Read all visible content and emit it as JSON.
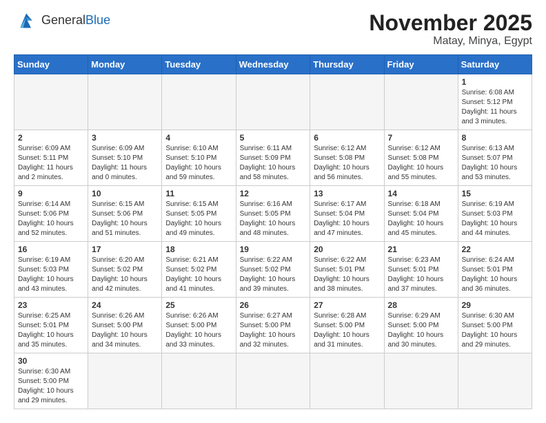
{
  "logo": {
    "text_general": "General",
    "text_blue": "Blue"
  },
  "title": "November 2025",
  "subtitle": "Matay, Minya, Egypt",
  "days_header": [
    "Sunday",
    "Monday",
    "Tuesday",
    "Wednesday",
    "Thursday",
    "Friday",
    "Saturday"
  ],
  "weeks": [
    [
      {
        "day": "",
        "info": ""
      },
      {
        "day": "",
        "info": ""
      },
      {
        "day": "",
        "info": ""
      },
      {
        "day": "",
        "info": ""
      },
      {
        "day": "",
        "info": ""
      },
      {
        "day": "",
        "info": ""
      },
      {
        "day": "1",
        "info": "Sunrise: 6:08 AM\nSunset: 5:12 PM\nDaylight: 11 hours and 3 minutes."
      }
    ],
    [
      {
        "day": "2",
        "info": "Sunrise: 6:09 AM\nSunset: 5:11 PM\nDaylight: 11 hours and 2 minutes."
      },
      {
        "day": "3",
        "info": "Sunrise: 6:09 AM\nSunset: 5:10 PM\nDaylight: 11 hours and 0 minutes."
      },
      {
        "day": "4",
        "info": "Sunrise: 6:10 AM\nSunset: 5:10 PM\nDaylight: 10 hours and 59 minutes."
      },
      {
        "day": "5",
        "info": "Sunrise: 6:11 AM\nSunset: 5:09 PM\nDaylight: 10 hours and 58 minutes."
      },
      {
        "day": "6",
        "info": "Sunrise: 6:12 AM\nSunset: 5:08 PM\nDaylight: 10 hours and 56 minutes."
      },
      {
        "day": "7",
        "info": "Sunrise: 6:12 AM\nSunset: 5:08 PM\nDaylight: 10 hours and 55 minutes."
      },
      {
        "day": "8",
        "info": "Sunrise: 6:13 AM\nSunset: 5:07 PM\nDaylight: 10 hours and 53 minutes."
      }
    ],
    [
      {
        "day": "9",
        "info": "Sunrise: 6:14 AM\nSunset: 5:06 PM\nDaylight: 10 hours and 52 minutes."
      },
      {
        "day": "10",
        "info": "Sunrise: 6:15 AM\nSunset: 5:06 PM\nDaylight: 10 hours and 51 minutes."
      },
      {
        "day": "11",
        "info": "Sunrise: 6:15 AM\nSunset: 5:05 PM\nDaylight: 10 hours and 49 minutes."
      },
      {
        "day": "12",
        "info": "Sunrise: 6:16 AM\nSunset: 5:05 PM\nDaylight: 10 hours and 48 minutes."
      },
      {
        "day": "13",
        "info": "Sunrise: 6:17 AM\nSunset: 5:04 PM\nDaylight: 10 hours and 47 minutes."
      },
      {
        "day": "14",
        "info": "Sunrise: 6:18 AM\nSunset: 5:04 PM\nDaylight: 10 hours and 45 minutes."
      },
      {
        "day": "15",
        "info": "Sunrise: 6:19 AM\nSunset: 5:03 PM\nDaylight: 10 hours and 44 minutes."
      }
    ],
    [
      {
        "day": "16",
        "info": "Sunrise: 6:19 AM\nSunset: 5:03 PM\nDaylight: 10 hours and 43 minutes."
      },
      {
        "day": "17",
        "info": "Sunrise: 6:20 AM\nSunset: 5:02 PM\nDaylight: 10 hours and 42 minutes."
      },
      {
        "day": "18",
        "info": "Sunrise: 6:21 AM\nSunset: 5:02 PM\nDaylight: 10 hours and 41 minutes."
      },
      {
        "day": "19",
        "info": "Sunrise: 6:22 AM\nSunset: 5:02 PM\nDaylight: 10 hours and 39 minutes."
      },
      {
        "day": "20",
        "info": "Sunrise: 6:22 AM\nSunset: 5:01 PM\nDaylight: 10 hours and 38 minutes."
      },
      {
        "day": "21",
        "info": "Sunrise: 6:23 AM\nSunset: 5:01 PM\nDaylight: 10 hours and 37 minutes."
      },
      {
        "day": "22",
        "info": "Sunrise: 6:24 AM\nSunset: 5:01 PM\nDaylight: 10 hours and 36 minutes."
      }
    ],
    [
      {
        "day": "23",
        "info": "Sunrise: 6:25 AM\nSunset: 5:01 PM\nDaylight: 10 hours and 35 minutes."
      },
      {
        "day": "24",
        "info": "Sunrise: 6:26 AM\nSunset: 5:00 PM\nDaylight: 10 hours and 34 minutes."
      },
      {
        "day": "25",
        "info": "Sunrise: 6:26 AM\nSunset: 5:00 PM\nDaylight: 10 hours and 33 minutes."
      },
      {
        "day": "26",
        "info": "Sunrise: 6:27 AM\nSunset: 5:00 PM\nDaylight: 10 hours and 32 minutes."
      },
      {
        "day": "27",
        "info": "Sunrise: 6:28 AM\nSunset: 5:00 PM\nDaylight: 10 hours and 31 minutes."
      },
      {
        "day": "28",
        "info": "Sunrise: 6:29 AM\nSunset: 5:00 PM\nDaylight: 10 hours and 30 minutes."
      },
      {
        "day": "29",
        "info": "Sunrise: 6:30 AM\nSunset: 5:00 PM\nDaylight: 10 hours and 29 minutes."
      }
    ],
    [
      {
        "day": "30",
        "info": "Sunrise: 6:30 AM\nSunset: 5:00 PM\nDaylight: 10 hours and 29 minutes."
      },
      {
        "day": "",
        "info": ""
      },
      {
        "day": "",
        "info": ""
      },
      {
        "day": "",
        "info": ""
      },
      {
        "day": "",
        "info": ""
      },
      {
        "day": "",
        "info": ""
      },
      {
        "day": "",
        "info": ""
      }
    ]
  ]
}
